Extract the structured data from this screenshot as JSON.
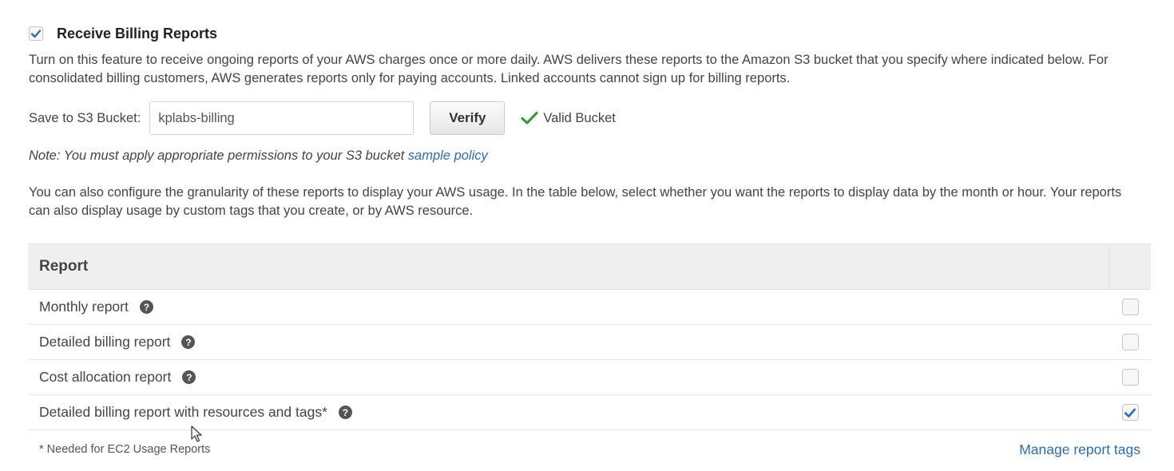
{
  "header": {
    "checkbox_checked": true,
    "title": "Receive Billing Reports"
  },
  "intro_text": "Turn on this feature to receive ongoing reports of your AWS charges once or more daily. AWS delivers these reports to the Amazon S3 bucket that you specify where indicated below. For consolidated billing customers, AWS generates reports only for paying accounts. Linked accounts cannot sign up for billing reports.",
  "bucket": {
    "label": "Save to S3 Bucket:",
    "value": "kplabs-billing",
    "verify_label": "Verify",
    "status_text": "Valid Bucket",
    "status_icon": "checkmark-icon"
  },
  "note": {
    "text": "Note: You must apply appropriate permissions to your S3 bucket",
    "link_text": "sample policy"
  },
  "granularity_text": "You can also configure the granularity of these reports to display your AWS usage. In the table below, select whether you want the reports to display data by the month or hour. Your reports can also display usage by custom tags that you create, or by AWS resource.",
  "table": {
    "header": "Report",
    "rows": [
      {
        "label": "Monthly report",
        "checked": false
      },
      {
        "label": "Detailed billing report",
        "checked": false
      },
      {
        "label": "Cost allocation report",
        "checked": false
      },
      {
        "label": "Detailed billing report with resources and tags*",
        "checked": true
      }
    ],
    "help_icon": "?"
  },
  "footnote": "* Needed for EC2 Usage Reports",
  "manage_link": "Manage report tags",
  "colors": {
    "link": "#2f6ca7",
    "check": "#2e6fb0",
    "valid_check": "#3a9a3a"
  }
}
